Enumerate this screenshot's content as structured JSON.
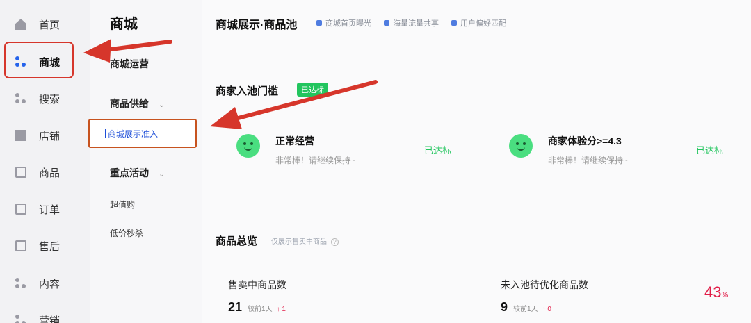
{
  "nav": {
    "items": [
      {
        "label": "首页",
        "icon": "home-icon"
      },
      {
        "label": "商城",
        "icon": "mall-icon",
        "active": true
      },
      {
        "label": "搜索",
        "icon": "search-icon"
      },
      {
        "label": "店铺",
        "icon": "store-icon"
      },
      {
        "label": "商品",
        "icon": "product-icon"
      },
      {
        "label": "订单",
        "icon": "order-icon"
      },
      {
        "label": "售后",
        "icon": "aftersale-icon"
      },
      {
        "label": "内容",
        "icon": "content-icon"
      },
      {
        "label": "营销",
        "icon": "marketing-icon"
      }
    ]
  },
  "subnav": {
    "title": "商城",
    "ops": "商城运营",
    "supply": "商品供给",
    "supply_active": "商城展示准入",
    "events": "重点活动",
    "ev1": "超值购",
    "ev2": "低价秒杀"
  },
  "main": {
    "title": "商城展示·商品池",
    "chips": [
      "商城首页曝光",
      "海量流量共享",
      "用户偏好匹配"
    ],
    "threshold_title": "商家入池门槛",
    "threshold_badge": "已达标",
    "cards": [
      {
        "title": "正常经营",
        "desc": "非常棒！请继续保持~",
        "status": "已达标"
      },
      {
        "title": "商家体验分>=4.3",
        "desc": "非常棒！请继续保持~",
        "status": "已达标"
      }
    ],
    "overview_title": "商品总览",
    "overview_note": "仅展示售卖中商品",
    "metrics": [
      {
        "label": "售卖中商品数",
        "value": "21",
        "compare": "较前1天",
        "change": "↑ 1"
      },
      {
        "label": "未入池待优化商品数",
        "value": "9",
        "compare": "较前1天",
        "change": "↑ 0"
      }
    ],
    "percent": "43",
    "percent_unit": "%"
  },
  "colors": {
    "accent": "#2563eb",
    "success": "#22c55e",
    "annotation": "#d6362b",
    "danger": "#e11d48"
  }
}
